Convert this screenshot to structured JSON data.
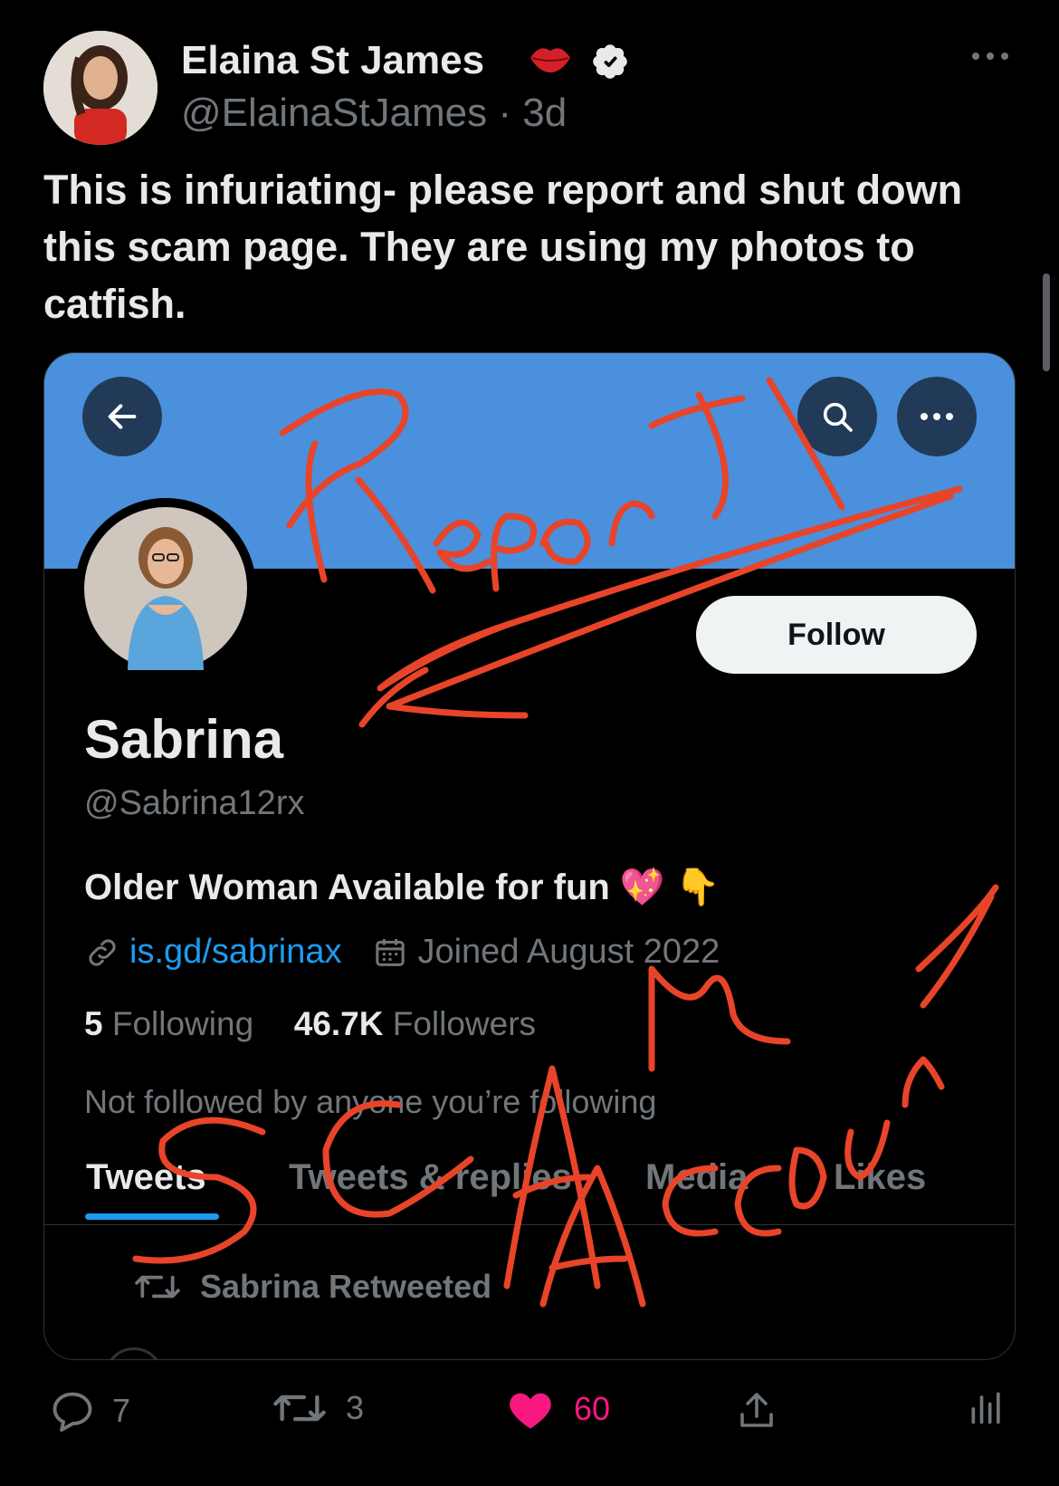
{
  "tweet": {
    "author_name": "Elaina St James",
    "handle": "@ElainaStJames",
    "separator": " · ",
    "age": "3d",
    "text": "This is infuriating- please report and shut down this scam page. They are using my photos to catfish."
  },
  "embedded_profile": {
    "follow_label": "Follow",
    "name": "Sabrina",
    "handle": "@Sabrina12rx",
    "bio": "Older Woman Available for fun 💖 👇",
    "link": "is.gd/sabrinax",
    "joined": "Joined August 2022",
    "following_count": "5",
    "following_label": "Following",
    "followers_count": "46.7K",
    "followers_label": "Followers",
    "not_followed": "Not followed by anyone you’re following",
    "tabs": [
      "Tweets",
      "Tweets & replies",
      "Media",
      "Likes"
    ],
    "active_tab": "Tweets",
    "retweeted_label": "Sabrina Retweeted"
  },
  "actions": {
    "replies": "7",
    "retweets": "3",
    "likes": "60"
  },
  "annotations": {
    "top": "Report",
    "bottom_1": "SCAM",
    "bottom_2": "ACCOUNT"
  },
  "colors": {
    "background": "#000000",
    "banner": "#4a90dc",
    "accent_blue": "#1d9bf0",
    "like_pink": "#f91880",
    "scribble_red": "#e8442a",
    "muted_text": "#71767b"
  }
}
